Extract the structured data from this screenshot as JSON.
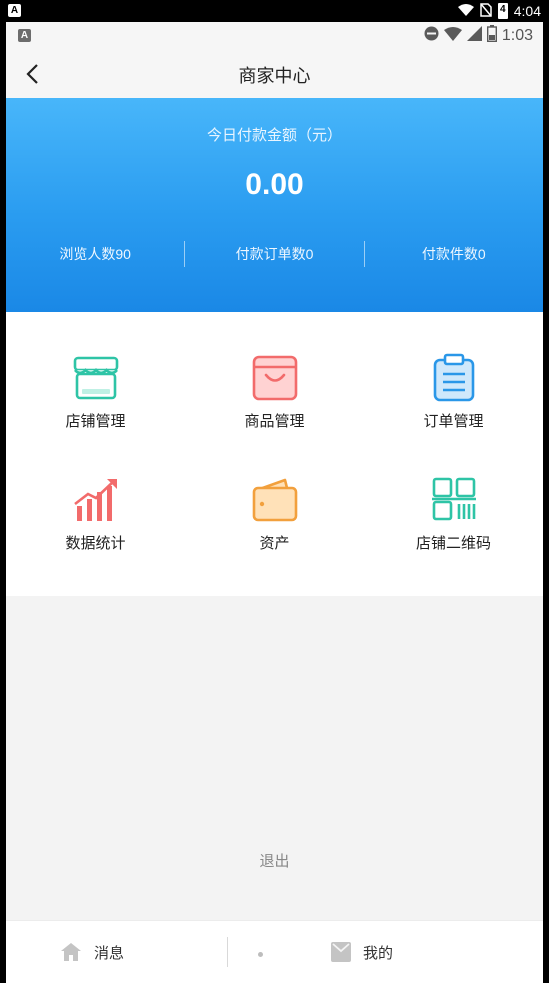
{
  "system_bar": {
    "time": "4:04",
    "battery": "4"
  },
  "status_bar": {
    "time": "1:03"
  },
  "nav": {
    "title": "商家中心"
  },
  "hero": {
    "label": "今日付款金额（元）",
    "amount": "0.00",
    "stats": [
      "浏览人数90",
      "付款订单数0",
      "付款件数0"
    ]
  },
  "menu": {
    "items": [
      {
        "label": "店铺管理",
        "icon": "store-icon",
        "color": "#2ec4a6"
      },
      {
        "label": "商品管理",
        "icon": "shopping-bag-icon",
        "color": "#f26b6b"
      },
      {
        "label": "订单管理",
        "icon": "clipboard-icon",
        "color": "#2a97e8"
      },
      {
        "label": "数据统计",
        "icon": "bar-chart-trend-icon",
        "color": "#f26b6b"
      },
      {
        "label": "资产",
        "icon": "wallet-icon",
        "color": "#f2a03d"
      },
      {
        "label": "店铺二维码",
        "icon": "qr-code-icon",
        "color": "#2ec4a6"
      }
    ]
  },
  "logout_label": "退出",
  "tabbar": {
    "items": [
      {
        "label": "消息",
        "icon": "home-icon"
      },
      {
        "label": "我的",
        "icon": "profile-card-icon"
      }
    ]
  }
}
